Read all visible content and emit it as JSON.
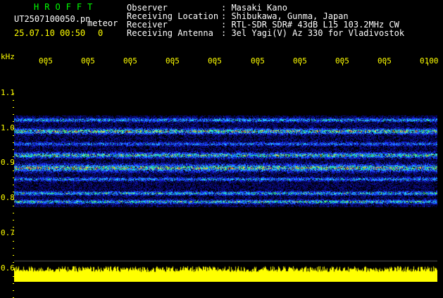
{
  "header": {
    "brand": "HROFFT",
    "filename": "UT2507100050.pn",
    "meteor_label": "meteor",
    "datetime": "25.07.10 00:50",
    "count": "0"
  },
  "info": {
    "rows": [
      {
        "label": "Observer",
        "value": "Masaki Kano"
      },
      {
        "label": "Receiving Location",
        "value": "Shibukawa, Gunma, Japan"
      },
      {
        "label": "Receiver",
        "value": "RTL-SDR SDR# 43dB L15 103.2MHz CW"
      },
      {
        "label": "Receiving Antenna",
        "value": "3el Yagi(V) Az 330 for Vladivostok"
      }
    ]
  },
  "axis": {
    "y_unit": "kHz",
    "y_ticks": [
      "1.1",
      "1.0",
      "0.9",
      "0.8",
      "0.7",
      "0.6"
    ],
    "x_ticks": [
      "005",
      "005",
      "005",
      "005",
      "005",
      "005",
      "005",
      "005",
      "005",
      "0100"
    ]
  },
  "colors": {
    "yellow": "#ffff00",
    "green": "#00ff00",
    "background": "#000000",
    "noise_blue": "#1a33ff"
  }
}
